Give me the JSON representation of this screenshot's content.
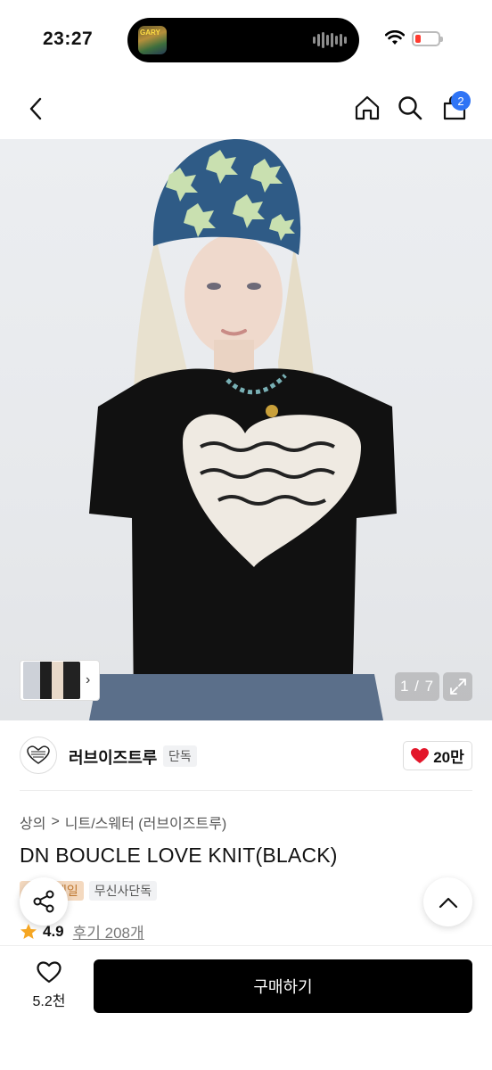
{
  "status_bar": {
    "time": "23:27",
    "now_playing_art_text": "GARY"
  },
  "nav": {
    "cart_count": "2",
    "icons": [
      "back-icon",
      "home-icon",
      "search-icon",
      "cart-icon"
    ]
  },
  "gallery": {
    "image_description_icon": "product-photo",
    "counter": "1 / 7",
    "thumbnail_arrow": "›"
  },
  "brand": {
    "name": "러브이즈트루",
    "exclusive_badge": "단독",
    "likes": "20만"
  },
  "breadcrumb": {
    "category": "상의",
    "separator": ">",
    "subcategory": "니트/스웨터 (러브이즈트루)"
  },
  "product": {
    "title": "DN BOUCLE LOVE KNIT(BLACK)",
    "tag_sale": "세일",
    "tag_exclusive": "무신사단독",
    "rating": "4.9",
    "reviews": "후기 208개"
  },
  "bottom": {
    "wish_count": "5.2천",
    "buy_label": "구매하기"
  },
  "colors": {
    "accent_blue": "#2f74f5",
    "heart_red": "#e3162a",
    "buy_black": "#000000",
    "star": "#f5a623"
  }
}
